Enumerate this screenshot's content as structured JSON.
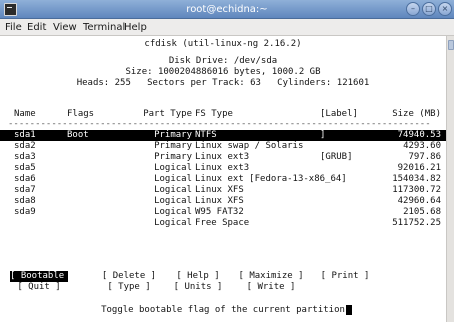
{
  "window": {
    "title": "root@echidna:~",
    "controls": {
      "minimize": "–",
      "maximize": "□",
      "close": "×"
    }
  },
  "menubar": {
    "items": [
      "File",
      "Edit",
      "View",
      "Terminal",
      "Help"
    ]
  },
  "terminal": {
    "program_title": "cfdisk (util-linux-ng 2.16.2)",
    "disk_drive": "Disk Drive: /dev/sda",
    "disk_size": "Size: 1000204886016 bytes, 1000.2 GB",
    "geometry": "Heads: 255   Sectors per Track: 63   Cylinders: 121601",
    "columns": {
      "name": "Name",
      "flags": "Flags",
      "part_type": "Part Type",
      "fs_type": "FS Type",
      "label": "[Label]",
      "size": "Size (MB)"
    },
    "separator": "------------------------------------------------------------------------------",
    "partitions": [
      {
        "name": "sda1",
        "flags": "Boot",
        "part_type": "Primary",
        "fs_type": "NTFS",
        "label": "]",
        "size": "74940.53",
        "selected": true
      },
      {
        "name": "sda2",
        "flags": "",
        "part_type": "Primary",
        "fs_type": "Linux swap / Solaris",
        "label": "",
        "size": "4293.60",
        "selected": false
      },
      {
        "name": "sda3",
        "flags": "",
        "part_type": "Primary",
        "fs_type": "Linux ext3",
        "label": "[GRUB]",
        "size": "797.86",
        "selected": false
      },
      {
        "name": "sda5",
        "flags": "",
        "part_type": "Logical",
        "fs_type": "Linux ext3",
        "label": "",
        "size": "92016.21",
        "selected": false
      },
      {
        "name": "sda6",
        "flags": "",
        "part_type": "Logical",
        "fs_type": "Linux ext [Fedora-13-x86_64]",
        "label": "",
        "size": "154034.82",
        "selected": false
      },
      {
        "name": "sda7",
        "flags": "",
        "part_type": "Logical",
        "fs_type": "Linux XFS",
        "label": "",
        "size": "117300.72",
        "selected": false
      },
      {
        "name": "sda8",
        "flags": "",
        "part_type": "Logical",
        "fs_type": "Linux XFS",
        "label": "",
        "size": "42960.64",
        "selected": false
      },
      {
        "name": "sda9",
        "flags": "",
        "part_type": "Logical",
        "fs_type": "W95 FAT32",
        "label": "",
        "size": "2105.68",
        "selected": false
      },
      {
        "name": "",
        "flags": "",
        "part_type": "Logical",
        "fs_type": "Free Space",
        "label": "",
        "size": "511752.25",
        "selected": false
      }
    ],
    "buttons_row1": [
      "Bootable",
      "Delete",
      "Help",
      "Maximize",
      "Print"
    ],
    "buttons_row2": [
      "Quit",
      "Type",
      "Units",
      "Write"
    ],
    "active_button": "Bootable",
    "status": "Toggle bootable flag of the current partition"
  }
}
